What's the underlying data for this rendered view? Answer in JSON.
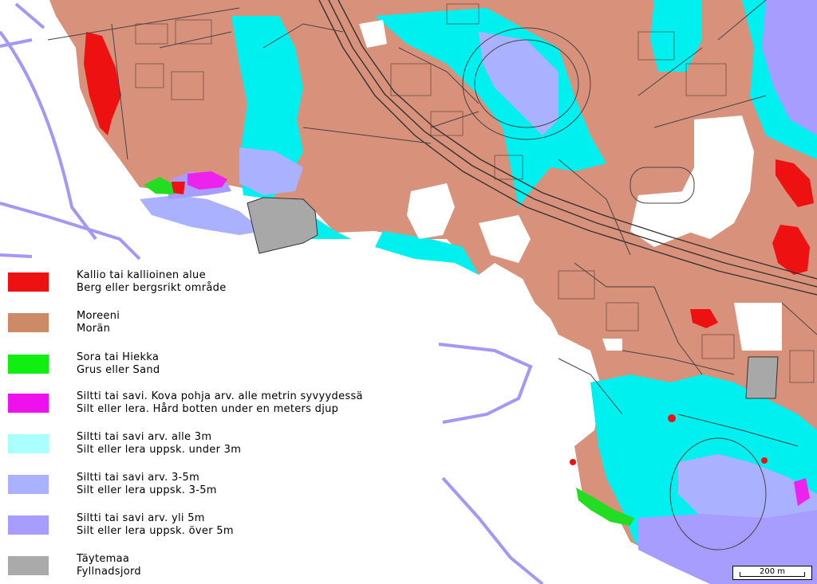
{
  "colors": {
    "water": "#ffffff",
    "moreeni": "#d8917a",
    "kallio": "#ee1111",
    "sora": "#22dd22",
    "siltti_kova": "#ee22ee",
    "siltti_under3": "#00eeee",
    "siltti_3_5": "#a8b0ff",
    "siltti_over5": "#a89cff",
    "taytemaa": "#a8a8a8",
    "shallow": "#9b8cf5",
    "linework": "#222222"
  },
  "legend": [
    {
      "swatch": "#ee1111",
      "fi": "Kallio tai kallioinen alue",
      "sv": "Berg eller bergsrikt område"
    },
    {
      "swatch": "#cd8a66",
      "fi": "Moreeni",
      "sv": "Morän"
    },
    {
      "swatch": "#11ee11",
      "fi": "Sora tai Hiekka",
      "sv": "Grus eller Sand"
    },
    {
      "swatch": "#ee11ee",
      "fi": "Siltti tai savi. Kova pohja arv. alle metrin syvyydessä",
      "sv": "Silt eller lera. Hård botten under en meters djup"
    },
    {
      "swatch": "#aaffff",
      "fi": "Siltti tai savi arv. alle 3m",
      "sv": "Silt eller lera uppsk. under 3m"
    },
    {
      "swatch": "#aab2ff",
      "fi": "Siltti tai savi arv. 3-5m",
      "sv": "Silt eller lera uppsk. 3-5m"
    },
    {
      "swatch": "#a79cff",
      "fi": "Siltti tai savi arv. yli 5m",
      "sv": "Silt eller lera uppsk. över 5m"
    },
    {
      "swatch": "#aaaaaa",
      "fi": "Täytemaa",
      "sv": "Fyllnadsjord"
    }
  ],
  "scale": {
    "label": "200 m"
  }
}
